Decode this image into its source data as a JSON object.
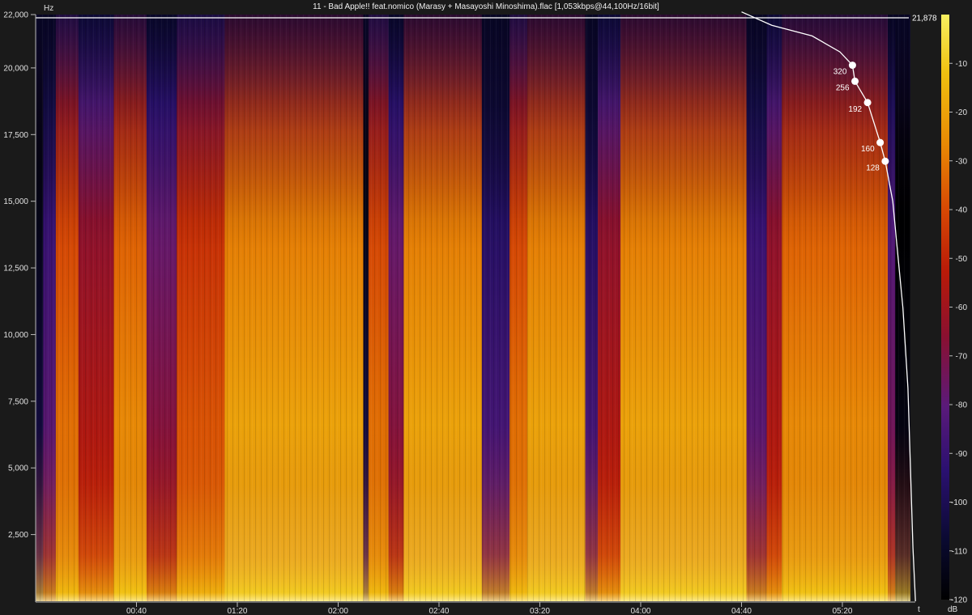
{
  "chart_data": {
    "type": "heatmap",
    "title": "11 - Bad Apple!! feat.nomico (Marasy + Masayoshi Minoshima).flac [1,053kbps@44,100Hz/16bit]",
    "xlabel": "t",
    "ylabel": "Hz",
    "colorbar_label": "dB",
    "x_unit": "mm:ss",
    "xlim": [
      "00:00",
      "05:47"
    ],
    "ylim": [
      0,
      22000
    ],
    "x_ticks": [
      "00:40",
      "01:20",
      "02:00",
      "02:40",
      "03:20",
      "04:00",
      "04:40",
      "05:20"
    ],
    "y_ticks": [
      22000,
      20000,
      17500,
      15000,
      12500,
      10000,
      7500,
      5000,
      2500
    ],
    "y_tick_labels": [
      "22,000",
      "20,000",
      "17,500",
      "15,000",
      "12,500",
      "10,000",
      "7,500",
      "5,000",
      "2,500"
    ],
    "colorbar_range": [
      -120,
      0
    ],
    "colorbar_ticks": [
      -10,
      -20,
      -30,
      -40,
      -50,
      -60,
      -70,
      -80,
      -90,
      -100,
      -110,
      -120
    ],
    "colorscale": [
      "#000000",
      "#0a0a30",
      "#2a1070",
      "#5a1a7a",
      "#8a1030",
      "#b81a08",
      "#d84a04",
      "#e88a04",
      "#f0c010",
      "#f8f060"
    ],
    "cutoff_line": {
      "value": 21878,
      "label": "21,878"
    },
    "bitrate_markers": [
      {
        "label": "320",
        "time": "05:24",
        "freq": 20100
      },
      {
        "label": "256",
        "time": "05:25",
        "freq": 19500
      },
      {
        "label": "192",
        "time": "05:30",
        "freq": 18700
      },
      {
        "label": "160",
        "time": "05:35",
        "freq": 17200
      },
      {
        "label": "128",
        "time": "05:37",
        "freq": 16500
      }
    ],
    "profile_line": [
      {
        "time": "04:40",
        "freq": 22100
      },
      {
        "time": "04:52",
        "freq": 21600
      },
      {
        "time": "05:08",
        "freq": 21200
      },
      {
        "time": "05:19",
        "freq": 20600
      },
      {
        "time": "05:24",
        "freq": 20100
      },
      {
        "time": "05:25",
        "freq": 19500
      },
      {
        "time": "05:30",
        "freq": 18700
      },
      {
        "time": "05:35",
        "freq": 17200
      },
      {
        "time": "05:37",
        "freq": 16500
      },
      {
        "time": "05:40",
        "freq": 15000
      },
      {
        "time": "05:42",
        "freq": 13000
      },
      {
        "time": "05:44",
        "freq": 11000
      },
      {
        "time": "05:46",
        "freq": 8000
      },
      {
        "time": "05:47",
        "freq": 5000
      },
      {
        "time": "05:48",
        "freq": 2000
      },
      {
        "time": "05:49",
        "freq": 0
      }
    ],
    "time_bands": [
      {
        "from": "00:00",
        "to": "00:03",
        "level": 0.15
      },
      {
        "from": "00:03",
        "to": "00:08",
        "level": 0.35
      },
      {
        "from": "00:08",
        "to": "00:17",
        "level": 0.75
      },
      {
        "from": "00:17",
        "to": "00:31",
        "level": 0.55
      },
      {
        "from": "00:31",
        "to": "00:44",
        "level": 0.8
      },
      {
        "from": "00:44",
        "to": "00:56",
        "level": 0.45
      },
      {
        "from": "00:56",
        "to": "01:15",
        "level": 0.7
      },
      {
        "from": "01:15",
        "to": "02:10",
        "level": 0.85
      },
      {
        "from": "02:10",
        "to": "02:12",
        "level": 0.15
      },
      {
        "from": "02:12",
        "to": "02:20",
        "level": 0.75
      },
      {
        "from": "02:20",
        "to": "02:26",
        "level": 0.45
      },
      {
        "from": "02:26",
        "to": "02:57",
        "level": 0.85
      },
      {
        "from": "02:57",
        "to": "03:08",
        "level": 0.3
      },
      {
        "from": "03:08",
        "to": "03:15",
        "level": 0.75
      },
      {
        "from": "03:15",
        "to": "03:38",
        "level": 0.85
      },
      {
        "from": "03:38",
        "to": "03:43",
        "level": 0.3
      },
      {
        "from": "03:43",
        "to": "03:52",
        "level": 0.55
      },
      {
        "from": "03:52",
        "to": "04:42",
        "level": 0.85
      },
      {
        "from": "04:42",
        "to": "04:50",
        "level": 0.35
      },
      {
        "from": "04:50",
        "to": "04:56",
        "level": 0.55
      },
      {
        "from": "04:56",
        "to": "05:38",
        "level": 0.8
      },
      {
        "from": "05:38",
        "to": "05:41",
        "level": 0.4
      },
      {
        "from": "05:41",
        "to": "05:47",
        "level": 0.05
      }
    ]
  }
}
